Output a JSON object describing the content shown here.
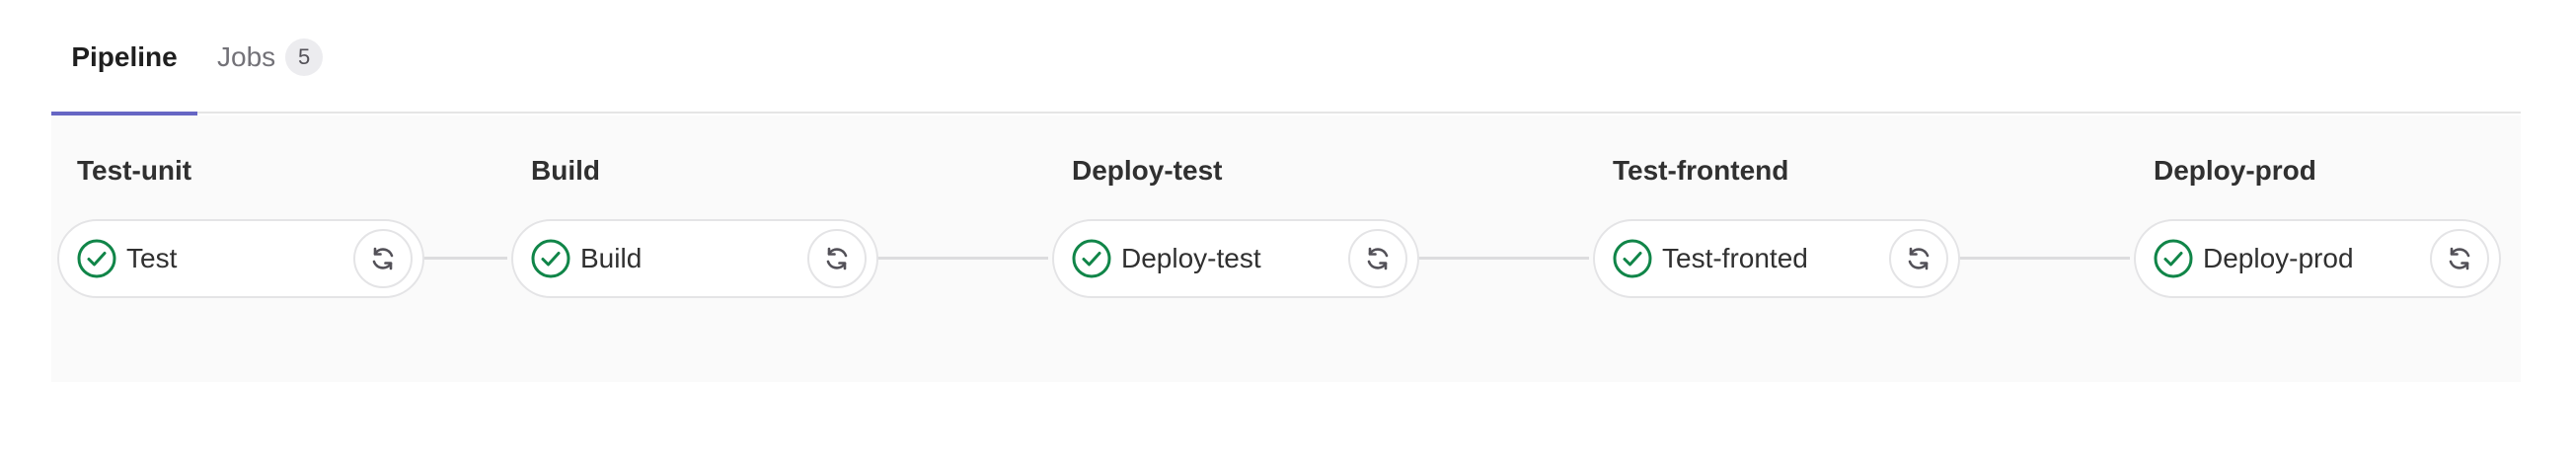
{
  "tabs": {
    "pipeline_label": "Pipeline",
    "jobs_label": "Jobs",
    "jobs_count": "5"
  },
  "colors": {
    "accent": "#6666c4",
    "success": "#108548",
    "panel_bg": "#fafafa"
  },
  "stages": [
    {
      "title": "Test-unit",
      "job": {
        "name": "Test",
        "status": "success",
        "status_icon": "check-circle-icon",
        "action_icon": "retry-icon"
      }
    },
    {
      "title": "Build",
      "job": {
        "name": "Build",
        "status": "success",
        "status_icon": "check-circle-icon",
        "action_icon": "retry-icon"
      }
    },
    {
      "title": "Deploy-test",
      "job": {
        "name": "Deploy-test",
        "status": "success",
        "status_icon": "check-circle-icon",
        "action_icon": "retry-icon"
      }
    },
    {
      "title": "Test-frontend",
      "job": {
        "name": "Test-fronted",
        "status": "success",
        "status_icon": "check-circle-icon",
        "action_icon": "retry-icon"
      }
    },
    {
      "title": "Deploy-prod",
      "job": {
        "name": "Deploy-prod",
        "status": "success",
        "status_icon": "check-circle-icon",
        "action_icon": "retry-icon"
      }
    }
  ]
}
